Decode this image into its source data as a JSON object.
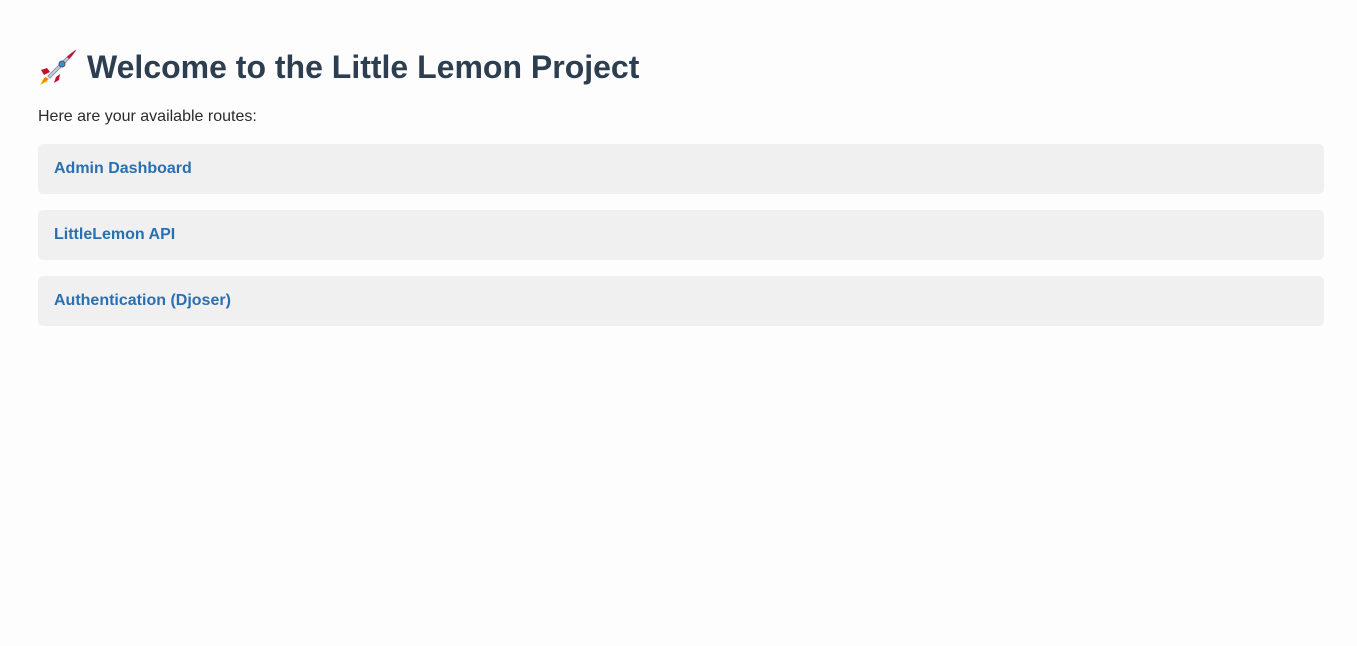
{
  "header": {
    "icon": "rocket-icon",
    "title": "Welcome to the Little Lemon Project"
  },
  "intro_text": "Here are your available routes:",
  "routes": [
    {
      "label": "Admin Dashboard"
    },
    {
      "label": "LittleLemon API"
    },
    {
      "label": "Authentication (Djoser)"
    }
  ],
  "colors": {
    "background": "#fdfdfd",
    "title": "#2c3e50",
    "link": "#2a6fb0",
    "card": "#f0f0f0"
  }
}
